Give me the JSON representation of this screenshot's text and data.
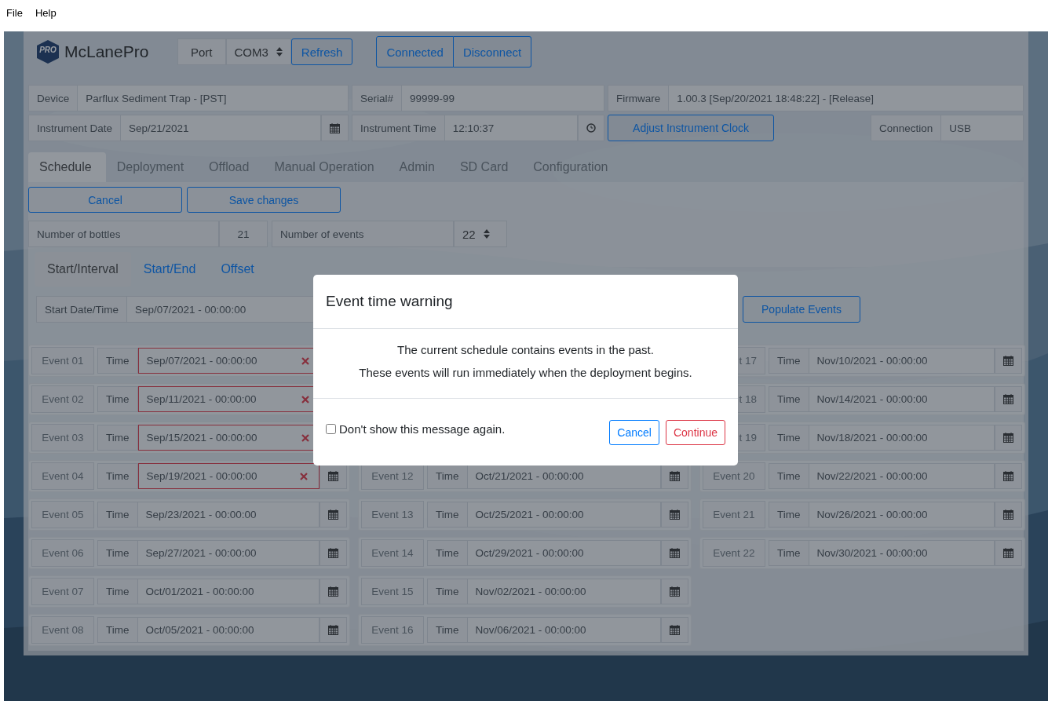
{
  "menu": [
    {
      "label": "File"
    },
    {
      "label": "Help"
    }
  ],
  "logo": {
    "mark": "PRO",
    "title": "McLanePro"
  },
  "port": {
    "label": "Port",
    "value": "COM3",
    "refresh": "Refresh"
  },
  "connection_buttons": [
    {
      "label": "Connected"
    },
    {
      "label": "Disconnect"
    }
  ],
  "device": {
    "label": "Device",
    "value": "Parflux Sediment Trap - [PST]"
  },
  "serial": {
    "label": "Serial#",
    "value": "99999-99"
  },
  "firmware": {
    "label": "Firmware",
    "value": "1.00.3 [Sep/20/2021 18:48:22] - [Release]"
  },
  "instrument_date": {
    "label": "Instrument Date",
    "value": "Sep/21/2021"
  },
  "instrument_time": {
    "label": "Instrument Time",
    "value": "12:10:37"
  },
  "adjust_clock": "Adjust Instrument Clock",
  "connection": {
    "label": "Connection",
    "value": "USB"
  },
  "tabs": [
    {
      "label": "Schedule",
      "selected": true
    },
    {
      "label": "Deployment",
      "selected": false
    },
    {
      "label": "Offload",
      "selected": false
    },
    {
      "label": "Manual Operation",
      "selected": false
    },
    {
      "label": "Admin",
      "selected": false
    },
    {
      "label": "SD Card",
      "selected": false
    },
    {
      "label": "Configuration",
      "selected": false
    }
  ],
  "actions": [
    {
      "label": "Cancel"
    },
    {
      "label": "Save changes"
    }
  ],
  "bottles": {
    "label": "Number of bottles",
    "value": "21"
  },
  "events_count": {
    "label": "Number of events",
    "value": "22"
  },
  "subtabs": [
    {
      "label": "Start/Interval",
      "selected": true
    },
    {
      "label": "Start/End",
      "selected": false
    },
    {
      "label": "Offset",
      "selected": false
    }
  ],
  "start": {
    "label": "Start Date/Time",
    "value": "Sep/07/2021 - 00:00:00",
    "populate": "Populate Events"
  },
  "event_columns": [
    [
      {
        "label": "Event 01",
        "time_label": "Time",
        "value": "Sep/07/2021 - 00:00:00",
        "past": true,
        "calendar": false
      },
      {
        "label": "Event 02",
        "time_label": "Time",
        "value": "Sep/11/2021 - 00:00:00",
        "past": true,
        "calendar": false
      },
      {
        "label": "Event 03",
        "time_label": "Time",
        "value": "Sep/15/2021 - 00:00:00",
        "past": true,
        "calendar": false
      },
      {
        "label": "Event 04",
        "time_label": "Time",
        "value": "Sep/19/2021 - 00:00:00",
        "past": true,
        "calendar": true
      },
      {
        "label": "Event 05",
        "time_label": "Time",
        "value": "Sep/23/2021 - 00:00:00",
        "past": false,
        "calendar": true
      },
      {
        "label": "Event 06",
        "time_label": "Time",
        "value": "Sep/27/2021 - 00:00:00",
        "past": false,
        "calendar": true
      },
      {
        "label": "Event 07",
        "time_label": "Time",
        "value": "Oct/01/2021 - 00:00:00",
        "past": false,
        "calendar": true
      },
      {
        "label": "Event 08",
        "time_label": "Time",
        "value": "Oct/05/2021 - 00:00:00",
        "past": false,
        "calendar": true
      }
    ],
    [
      {
        "label": "Event 12",
        "time_label": "Time",
        "value": "Oct/21/2021 - 00:00:00",
        "past": false,
        "calendar": true
      },
      {
        "label": "Event 13",
        "time_label": "Time",
        "value": "Oct/25/2021 - 00:00:00",
        "past": false,
        "calendar": true
      },
      {
        "label": "Event 14",
        "time_label": "Time",
        "value": "Oct/29/2021 - 00:00:00",
        "past": false,
        "calendar": true
      },
      {
        "label": "Event 15",
        "time_label": "Time",
        "value": "Nov/02/2021 - 00:00:00",
        "past": false,
        "calendar": true
      },
      {
        "label": "Event 16",
        "time_label": "Time",
        "value": "Nov/06/2021 - 00:00:00",
        "past": false,
        "calendar": true
      }
    ],
    [
      {
        "label": "t 17",
        "time_label": "Time",
        "value": "Nov/10/2021 - 00:00:00",
        "past": false,
        "calendar": true
      },
      {
        "label": "t 18",
        "time_label": "Time",
        "value": "Nov/14/2021 - 00:00:00",
        "past": false,
        "calendar": true
      },
      {
        "label": "t 19",
        "time_label": "Time",
        "value": "Nov/18/2021 - 00:00:00",
        "past": false,
        "calendar": true
      },
      {
        "label": "Event 20",
        "time_label": "Time",
        "value": "Nov/22/2021 - 00:00:00",
        "past": false,
        "calendar": true
      },
      {
        "label": "Event 21",
        "time_label": "Time",
        "value": "Nov/26/2021 - 00:00:00",
        "past": false,
        "calendar": true
      },
      {
        "label": "Event 22",
        "time_label": "Time",
        "value": "Nov/30/2021 - 00:00:00",
        "past": false,
        "calendar": true
      }
    ]
  ],
  "modal": {
    "title": "Event time warning",
    "messages": [
      "The current schedule contains events in the past.",
      "These events will run immediately when the deployment begins."
    ],
    "checkbox": {
      "label": "Don't show this message again.",
      "checked": false
    },
    "buttons": [
      {
        "label": "Cancel",
        "kind": "primary"
      },
      {
        "label": "Continue",
        "kind": "danger"
      }
    ]
  }
}
